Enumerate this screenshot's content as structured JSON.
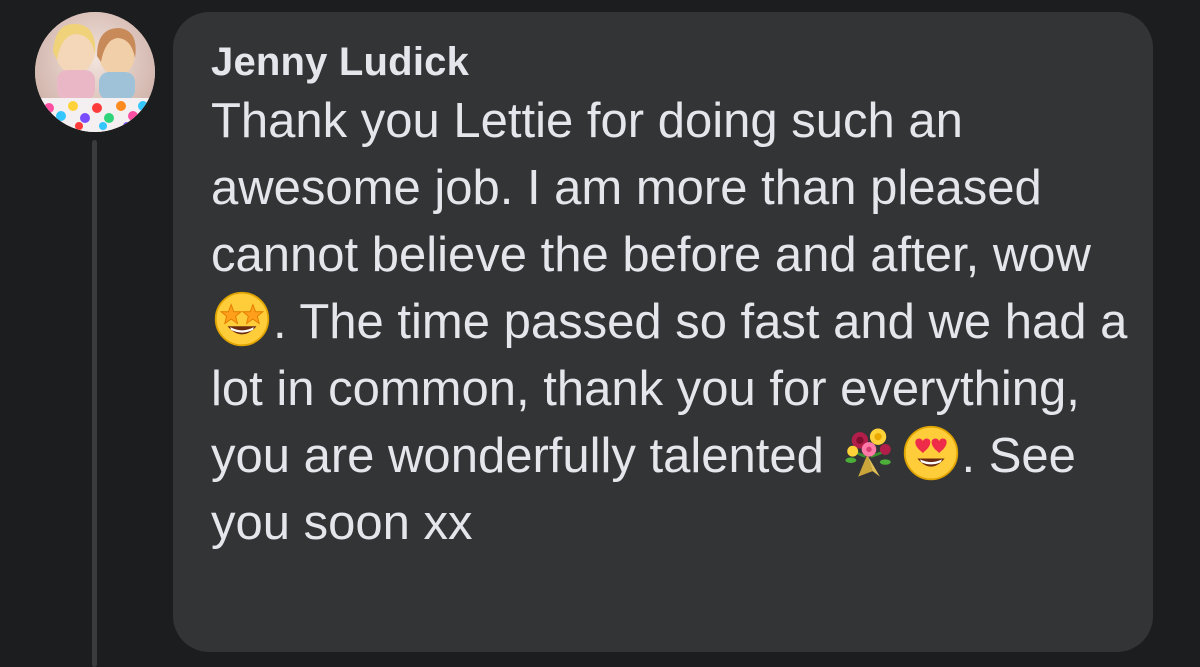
{
  "comment": {
    "author": "Jenny Ludick",
    "text_part_1": "Thank you Lettie for doing such an awesome job.  I am more than pleased cannot believe the before and after, wow ",
    "emoji_1": "star-struck-emoji",
    "text_part_2": ". The time passed so fast and we had a lot in common, thank you for everything, you are wonderfully talented ",
    "emoji_2": "bouquet-emoji",
    "emoji_3": "heart-eyes-emoji",
    "text_part_3": ". See you soon xx"
  },
  "colors": {
    "background": "#1c1d1f",
    "bubble": "#333436",
    "text": "#e4e6eb",
    "thread_line": "#3a3b3d"
  }
}
